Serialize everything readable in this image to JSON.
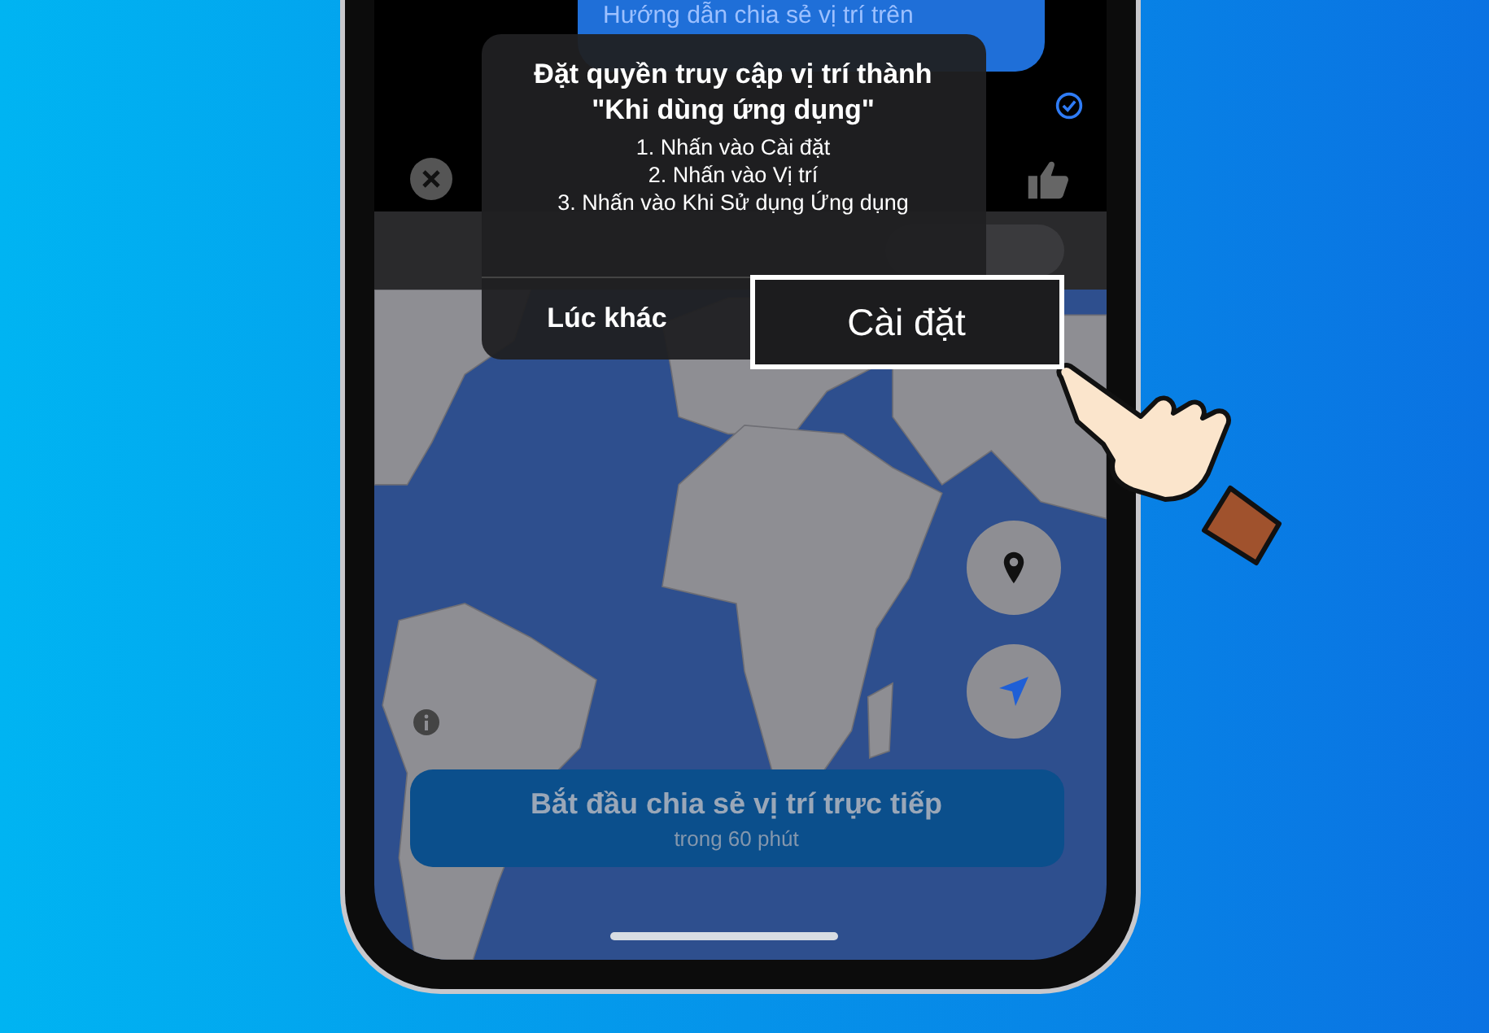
{
  "message": {
    "text": "Hướng dẫn chia sẻ vị trí trên"
  },
  "dialog": {
    "title": "Đặt quyền truy cập vị trí thành \"Khi dùng ứng dụng\"",
    "steps": [
      "1. Nhấn vào Cài đặt",
      "2. Nhấn vào Vị trí",
      "3. Nhấn vào Khi Sử dụng Ứng dụng"
    ],
    "buttons": [
      {
        "label": "Lúc khác",
        "highlighted": false
      },
      {
        "label": "Cài đặt",
        "highlighted": true
      }
    ]
  },
  "share_button": {
    "title": "Bắt đầu chia sẻ vị trí trực tiếp",
    "subtitle": "trong 60 phút"
  }
}
